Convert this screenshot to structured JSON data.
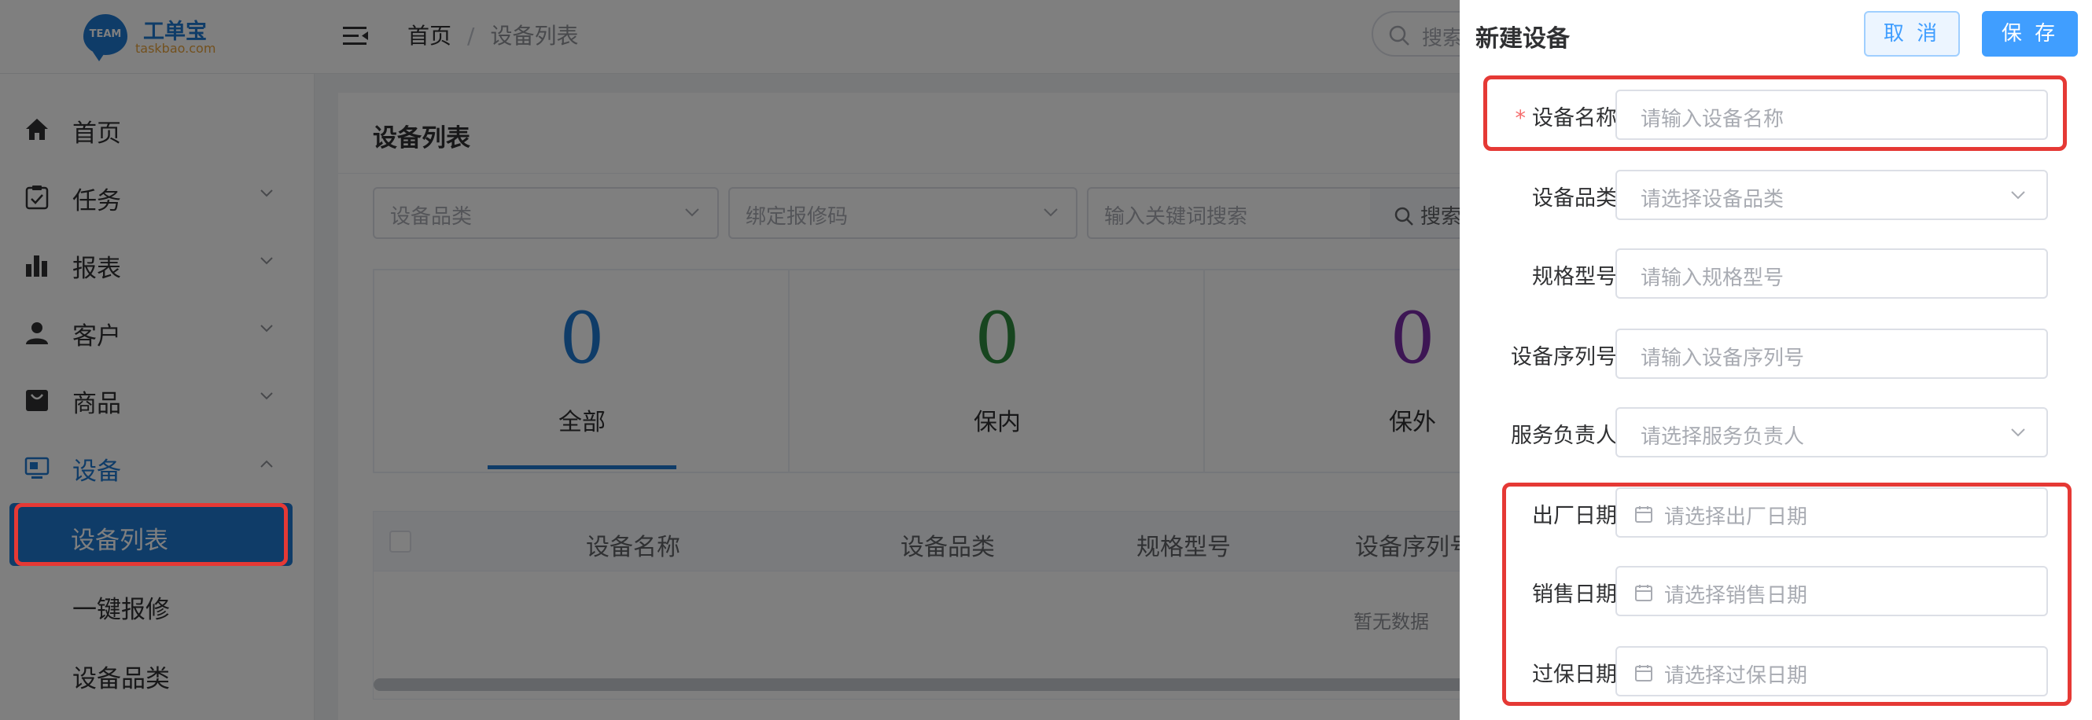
{
  "brand": {
    "logo_mark": "TEAM",
    "name": "工单宝",
    "domain": "taskbao.com"
  },
  "header": {
    "breadcrumb": [
      "首页",
      "设备列表"
    ],
    "breadcrumb_sep": "/",
    "search_placeholder": "搜索"
  },
  "sidebar": {
    "items": [
      {
        "label": "首页",
        "icon": "home-icon"
      },
      {
        "label": "任务",
        "icon": "task-icon"
      },
      {
        "label": "报表",
        "icon": "bar-chart-icon"
      },
      {
        "label": "客户",
        "icon": "user-icon"
      },
      {
        "label": "商品",
        "icon": "shop-icon"
      },
      {
        "label": "设备",
        "icon": "device-icon"
      }
    ],
    "sub_items": [
      "设备列表",
      "一键报修",
      "设备品类"
    ]
  },
  "main": {
    "title": "设备列表",
    "filters": {
      "category_placeholder": "设备品类",
      "code_placeholder": "绑定报修码",
      "keyword_placeholder": "输入关键词搜索",
      "search_label": "搜索"
    },
    "stats": [
      {
        "value": "0",
        "label": "全部",
        "color": "#1f78d1"
      },
      {
        "value": "0",
        "label": "保内",
        "color": "#2e8b3e"
      },
      {
        "value": "0",
        "label": "保外",
        "color": "#7b2ca8"
      }
    ],
    "table": {
      "columns": [
        "设备名称",
        "设备品类",
        "规格型号",
        "设备序列号"
      ],
      "empty_text": "暂无数据"
    }
  },
  "drawer": {
    "title": "新建设备",
    "cancel_label": "取 消",
    "save_label": "保 存",
    "fields": [
      {
        "label": "设备名称",
        "placeholder": "请输入设备名称",
        "required": "*"
      },
      {
        "label": "设备品类",
        "placeholder": "请选择设备品类"
      },
      {
        "label": "规格型号",
        "placeholder": "请输入规格型号"
      },
      {
        "label": "设备序列号",
        "placeholder": "请输入设备序列号"
      },
      {
        "label": "服务负责人",
        "placeholder": "请选择服务负责人"
      },
      {
        "label": "出厂日期",
        "placeholder": "请选择出厂日期"
      },
      {
        "label": "销售日期",
        "placeholder": "请选择销售日期"
      },
      {
        "label": "过保日期",
        "placeholder": "请选择过保日期"
      }
    ]
  },
  "colors": {
    "accent": "#1f78d1",
    "primary_button": "#409eff",
    "highlight": "#e53935",
    "required": "#f56c6c"
  }
}
